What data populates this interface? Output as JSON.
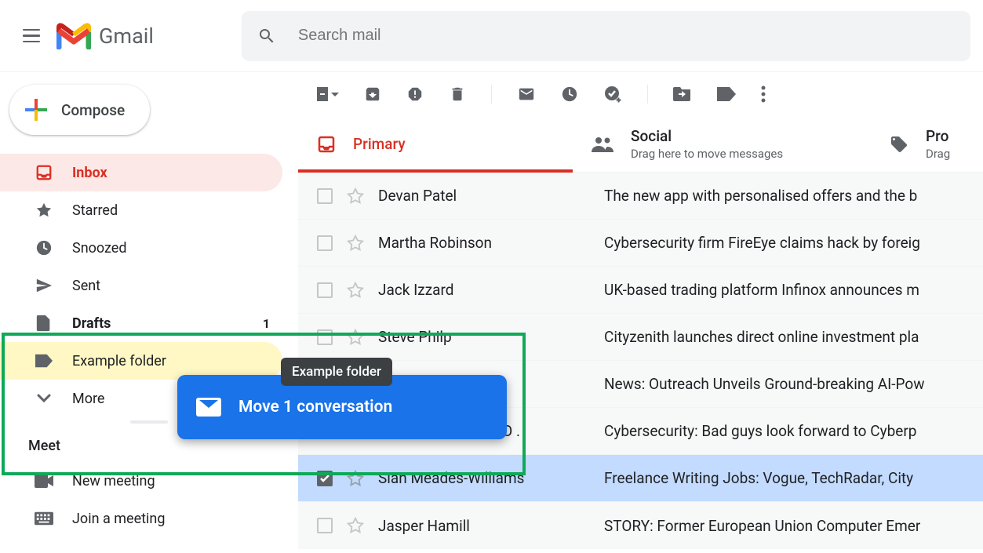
{
  "app": {
    "name": "Gmail"
  },
  "search": {
    "placeholder": "Search mail"
  },
  "compose": {
    "label": "Compose"
  },
  "sidebar": {
    "items": [
      {
        "label": "Inbox"
      },
      {
        "label": "Starred"
      },
      {
        "label": "Snoozed"
      },
      {
        "label": "Sent"
      },
      {
        "label": "Drafts",
        "count": "1"
      },
      {
        "label": "Example folder"
      },
      {
        "label": "More"
      }
    ],
    "meet": {
      "title": "Meet",
      "new": "New meeting",
      "join": "Join a meeting"
    }
  },
  "tabs": {
    "primary": "Primary",
    "social": {
      "title": "Social",
      "sub": "Drag here to move messages"
    },
    "promotions": {
      "title": "Pro",
      "sub": "Drag"
    }
  },
  "emails": [
    {
      "sender": "Devan Patel",
      "subject": "The new app with personalised offers and the b"
    },
    {
      "sender": "Martha Robinson",
      "subject": "Cybersecurity firm FireEye claims hack by foreig"
    },
    {
      "sender": "Jack Izzard",
      "subject": "UK-based trading platform Infinox announces m"
    },
    {
      "sender": "Steve Philp",
      "subject": "Cityzenith launches direct online investment pla"
    },
    {
      "sender": "",
      "subject": "News: Outreach Unveils Ground-breaking AI-Pow"
    },
    {
      "sender": "News Release - APO .",
      "subject": "Cybersecurity: Bad guys look forward to Cyberp"
    },
    {
      "sender": "Sian Meades-Williams",
      "subject": "Freelance Writing Jobs: Vogue, TechRadar, City "
    },
    {
      "sender": "Jasper Hamill",
      "subject": "STORY: Former European Union Computer Emer"
    }
  ],
  "drag": {
    "tooltip": "Example folder",
    "overlay": "Move 1 conversation"
  }
}
